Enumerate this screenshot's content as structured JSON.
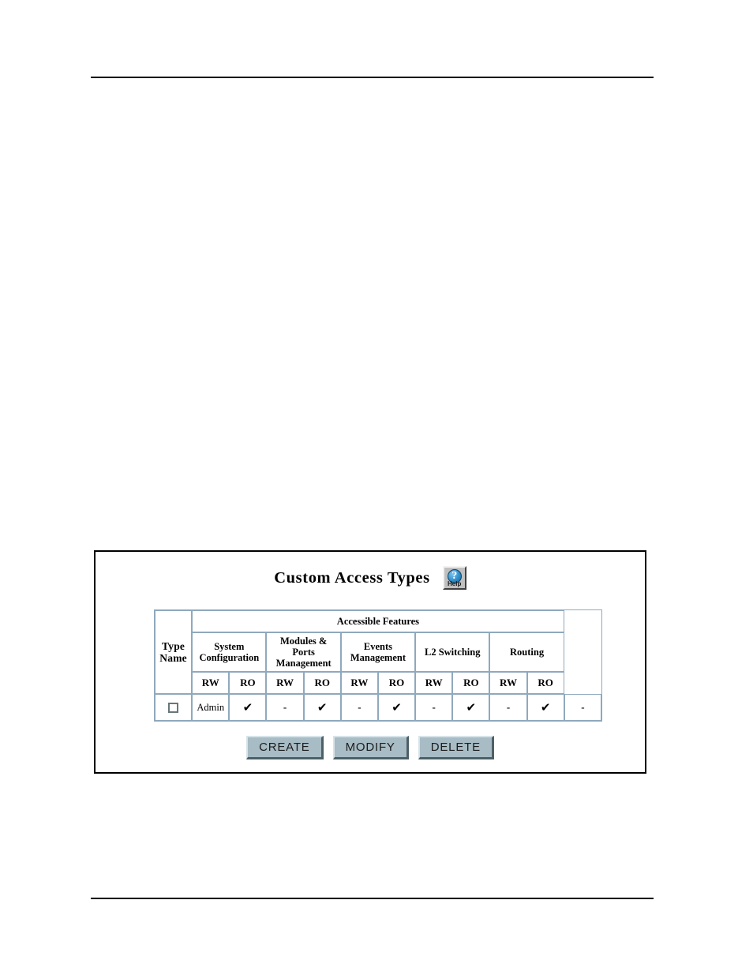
{
  "page": {
    "rules_visible": true
  },
  "panel": {
    "title": "Custom Access Types",
    "help": {
      "icon": "help-question-icon",
      "label": "Help"
    }
  },
  "table": {
    "group_header": "Accessible Features",
    "type_name_header": "Type Name",
    "feature_groups": [
      "System Configuration",
      "Modules & Ports Management",
      "Events Management",
      "L2 Switching",
      "Routing"
    ],
    "access_headers": [
      "RW",
      "RO",
      "RW",
      "RO",
      "RW",
      "RO",
      "RW",
      "RO",
      "RW",
      "RO"
    ],
    "rows": [
      {
        "selected": false,
        "type_name": "Admin",
        "cells": [
          "✔",
          "-",
          "✔",
          "-",
          "✔",
          "-",
          "✔",
          "-",
          "✔",
          "-"
        ]
      }
    ]
  },
  "buttons": {
    "create": "CREATE",
    "modify": "MODIFY",
    "delete": "DELETE"
  },
  "colors": {
    "table_border": "#8fa9bd",
    "button_face": "#a7bcc4",
    "help_blue": "#2f8ecb",
    "frame_border": "#000000"
  }
}
